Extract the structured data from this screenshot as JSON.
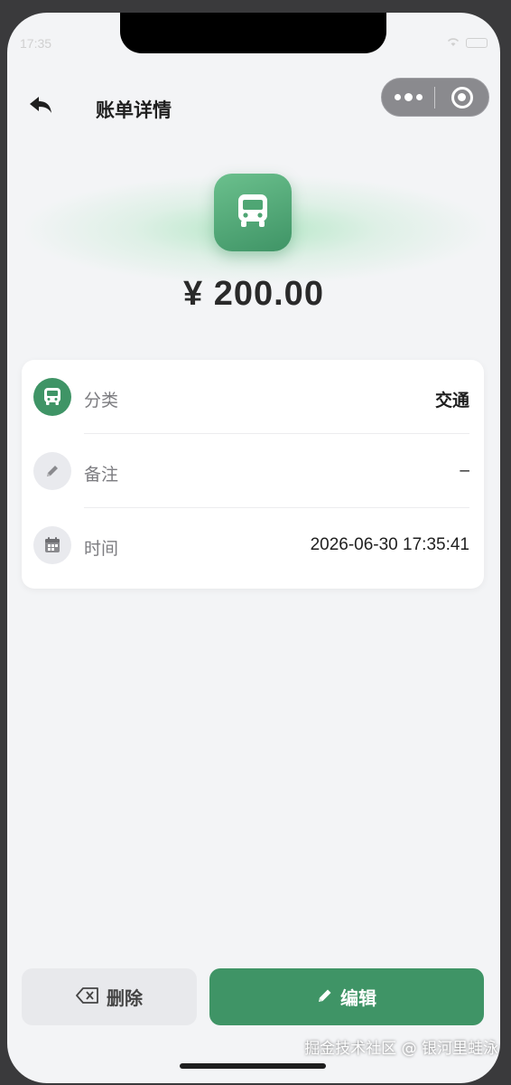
{
  "status": {
    "time": "17:35"
  },
  "nav": {
    "title": "账单详情",
    "back_icon": "back-arrow-icon",
    "more_icon": "more-dots-icon",
    "close_icon": "target-ring-icon"
  },
  "hero": {
    "category_icon": "bus-icon",
    "amount": "¥ 200.00"
  },
  "details": [
    {
      "label": "分类",
      "value": "交通",
      "icon": "bus-icon"
    },
    {
      "label": "备注",
      "value": "–",
      "icon": "pencil-icon"
    },
    {
      "label": "时间",
      "value": "2026-06-30 17:35:41",
      "icon": "calendar-icon"
    }
  ],
  "actions": {
    "delete_label": "删除",
    "delete_icon": "backspace-icon",
    "edit_label": "编辑",
    "edit_icon": "pencil-icon"
  },
  "watermark": "掘金技术社区 @ 银河里蛙泳",
  "colors": {
    "accent": "#3f9466",
    "background": "#f3f4f6",
    "card": "#ffffff"
  }
}
